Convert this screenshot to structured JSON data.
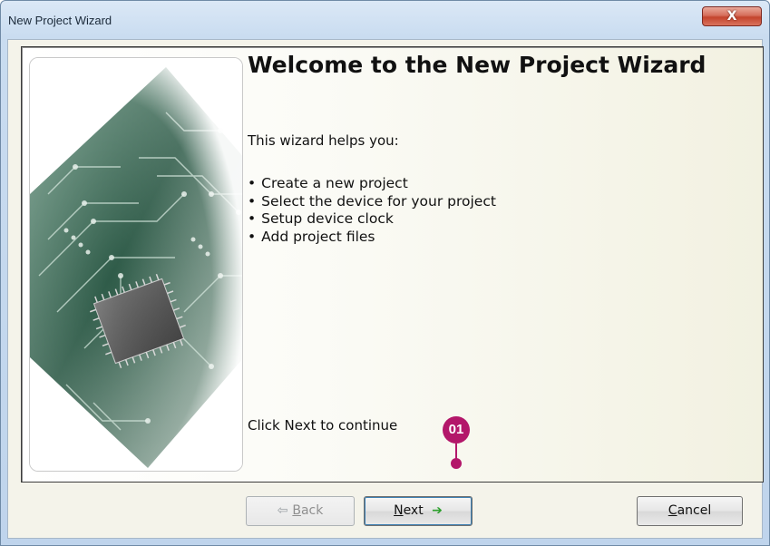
{
  "window": {
    "title": "New Project Wizard",
    "close_label": "X"
  },
  "wizard": {
    "heading": "Welcome to the New Project Wizard",
    "intro": "This wizard helps you:",
    "bullets": [
      "Create a new project",
      "Select the device for your project",
      "Setup device clock",
      "Add project files"
    ],
    "continue_text": "Click Next to continue"
  },
  "buttons": {
    "back": {
      "mnemonic": "B",
      "rest": "ack",
      "arrow": "⇦"
    },
    "next": {
      "mnemonic": "N",
      "rest": "ext",
      "arrow": "➔"
    },
    "cancel": {
      "mnemonic": "C",
      "rest": "ancel"
    }
  },
  "annotation": {
    "label": "01",
    "color": "#b3176a"
  },
  "colors": {
    "next_arrow": "#2ca02c",
    "back_arrow": "#9aa0a4"
  }
}
